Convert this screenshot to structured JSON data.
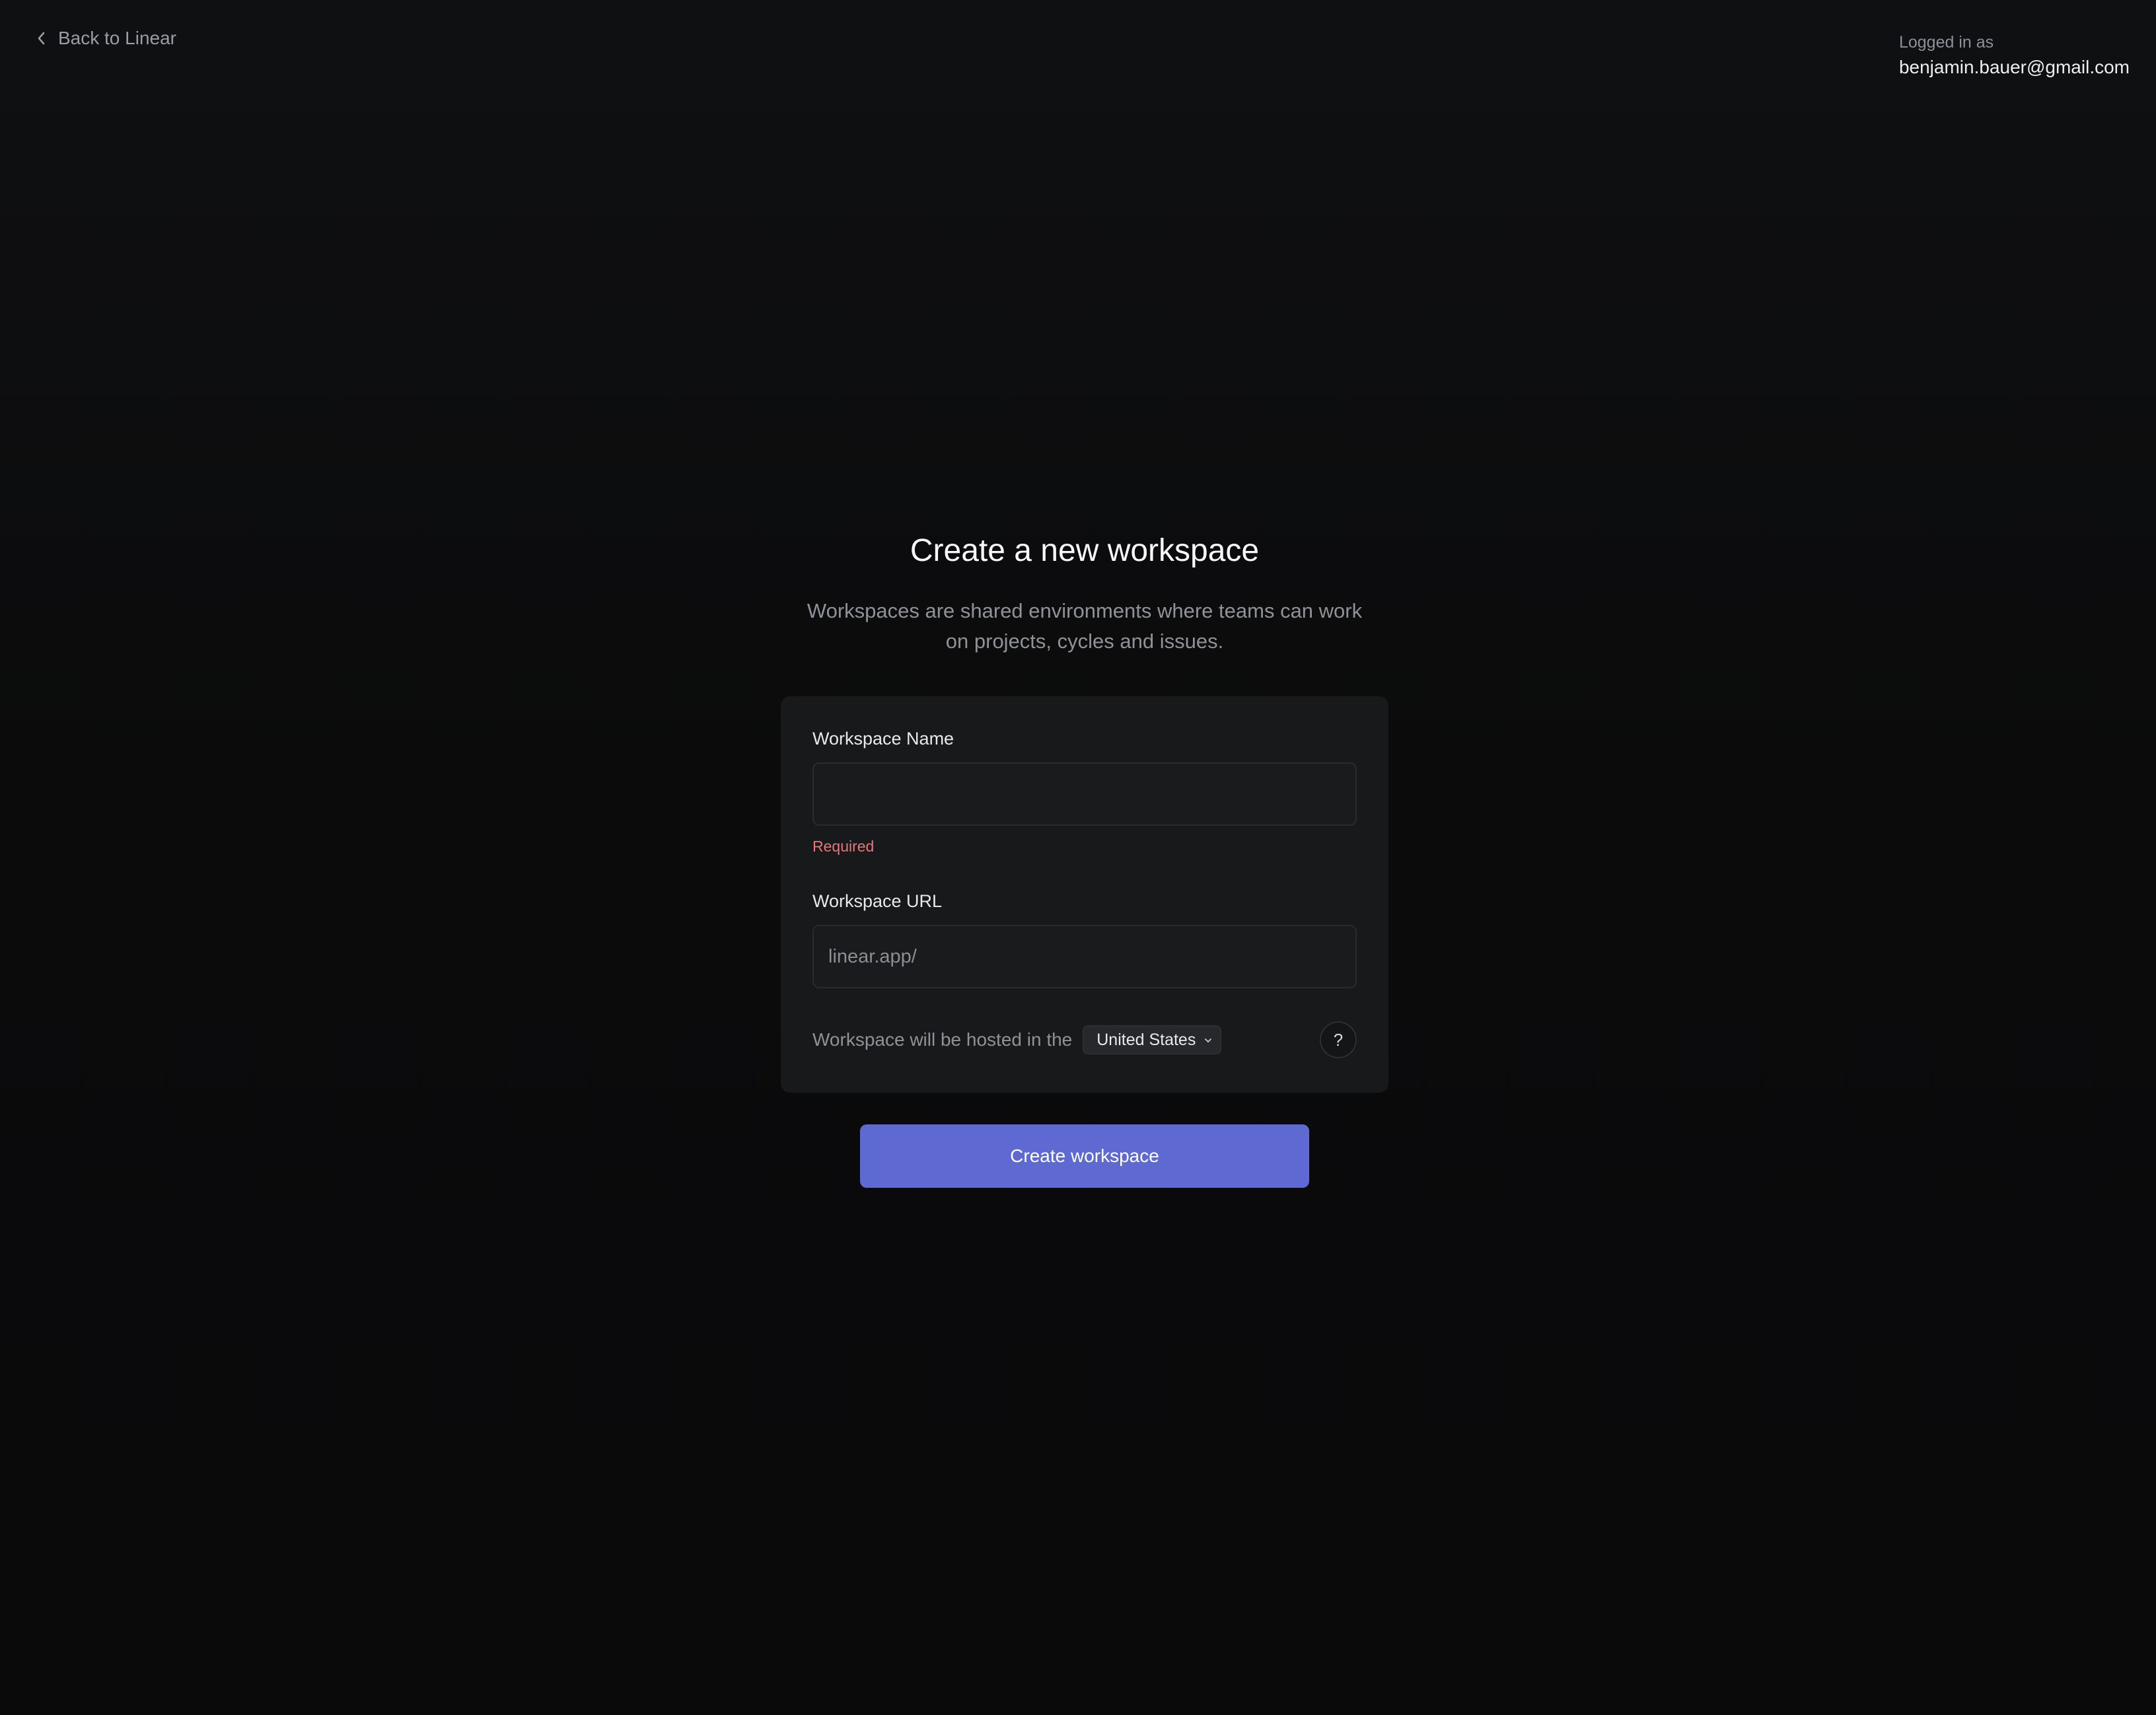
{
  "nav": {
    "back_label": "Back to Linear"
  },
  "account": {
    "caption": "Logged in as",
    "email": "benjamin.bauer@gmail.com"
  },
  "page": {
    "title": "Create a new workspace",
    "subtitle": "Workspaces are shared environments where teams can work on projects, cycles and issues."
  },
  "form": {
    "name_label": "Workspace Name",
    "name_value": "",
    "name_error": "Required",
    "url_label": "Workspace URL",
    "url_prefix": "linear.app/",
    "url_value": "",
    "host_text": "Workspace will be hosted in the",
    "region_selected": "United States",
    "help_label": "?"
  },
  "actions": {
    "create_label": "Create workspace"
  },
  "colors": {
    "accent": "#5e6ad2",
    "error": "#e5767b",
    "background": "#0f1012",
    "card": "#18191b"
  },
  "icons": {
    "back": "chevron-left-icon",
    "dropdown": "chevron-down-icon"
  }
}
